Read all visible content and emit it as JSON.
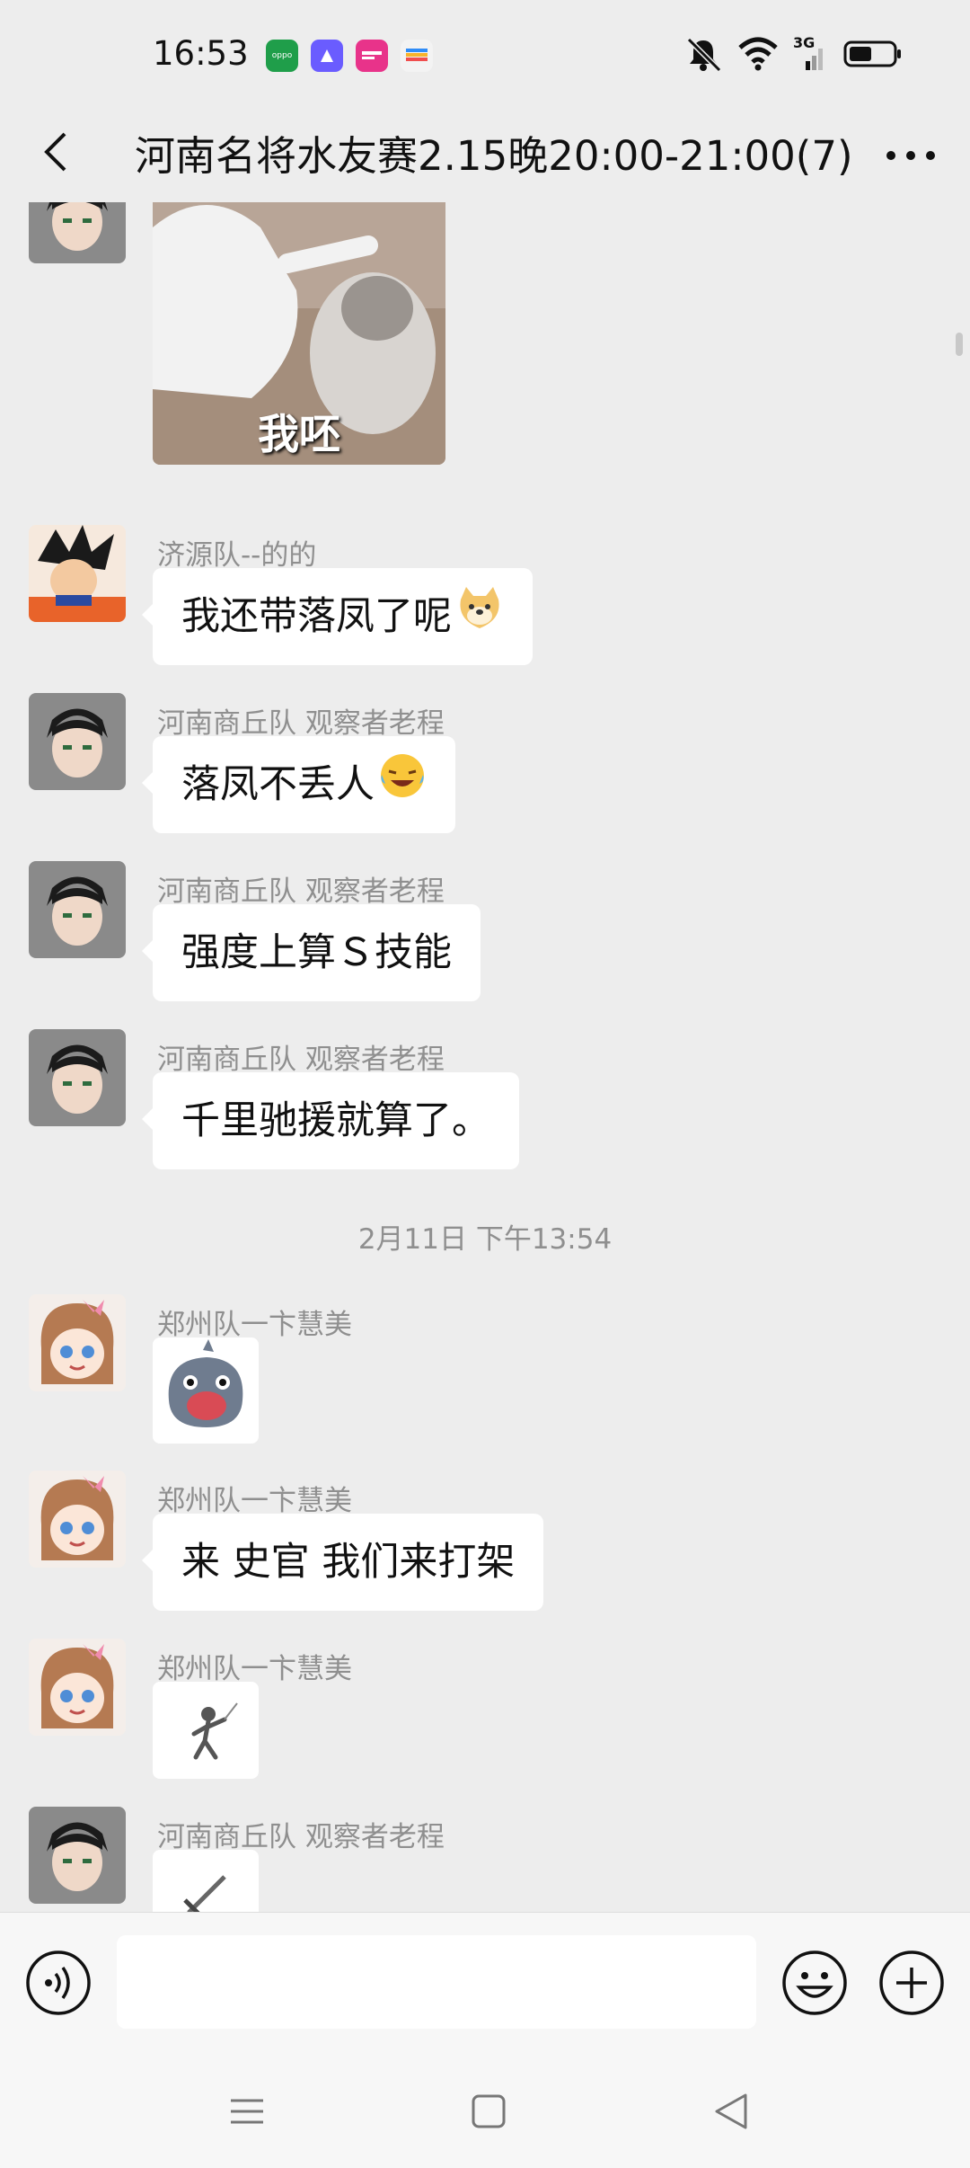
{
  "status_bar": {
    "time": "16:53",
    "app_icons": [
      {
        "name": "oppo-app-icon",
        "label": "oppo",
        "color": "#1f9e4a"
      },
      {
        "name": "blue-app-icon",
        "label": "",
        "color": "#6a5cff"
      },
      {
        "name": "pink-app-icon",
        "label": "",
        "color": "#e8338a"
      },
      {
        "name": "wallet-app-icon",
        "label": "",
        "color": "#f3f3f3"
      }
    ],
    "network_label": "3G"
  },
  "header": {
    "title": "河南名将水友赛2.15晚20:00-21:00(7)"
  },
  "messages": [
    {
      "sender": "",
      "sticker_caption": "我呸"
    },
    {
      "sender": "济源队--的的",
      "text": "我还带落凤了呢"
    },
    {
      "sender": "河南商丘队 观察者老程",
      "text": "落凤不丢人"
    },
    {
      "sender": "河南商丘队 观察者老程",
      "text": "强度上算Ｓ技能"
    },
    {
      "sender": "河南商丘队 观察者老程",
      "text": "千里驰援就算了。"
    },
    {
      "sender": "郑州队一卞慧美",
      "text": ""
    },
    {
      "sender": "郑州队一卞慧美",
      "text": "来 史官 我们来打架"
    },
    {
      "sender": "郑州队一卞慧美",
      "text": ""
    },
    {
      "sender": "河南商丘队 观察者老程",
      "text": ""
    }
  ],
  "timestamp": "2月11日 下午13:54",
  "input": {
    "placeholder": ""
  },
  "colors": {
    "background": "#ededed",
    "bubble": "#ffffff",
    "meta_text": "#8f8f8f"
  }
}
